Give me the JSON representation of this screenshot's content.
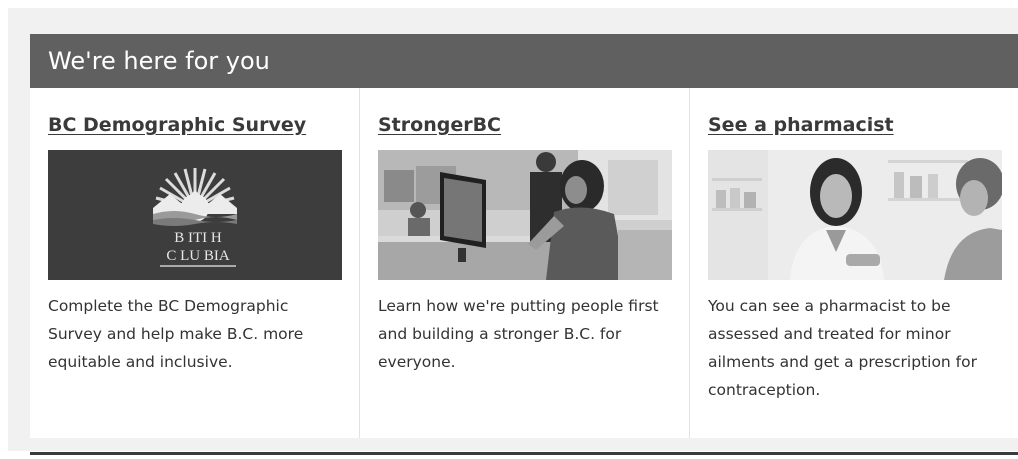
{
  "section": {
    "title": "We're here for you"
  },
  "cards": [
    {
      "title": "BC Demographic Survey",
      "text": "Complete the BC Demographic Survey and help make B.C. more equitable and inclusive.",
      "logo_text_line1": "B  ITI  H",
      "logo_text_line2": "C  LU  BIA"
    },
    {
      "title": "StrongerBC",
      "text": "Learn how we're putting people first and building a stronger B.C. for everyone."
    },
    {
      "title": "See a pharmacist",
      "text": "You can see a pharmacist to be assessed and treated for minor ailments and get a prescription for contraception."
    }
  ],
  "colors": {
    "header_bg": "#606060",
    "logo_bg": "#3d3d3d",
    "page_bg": "#f1f1f1"
  }
}
